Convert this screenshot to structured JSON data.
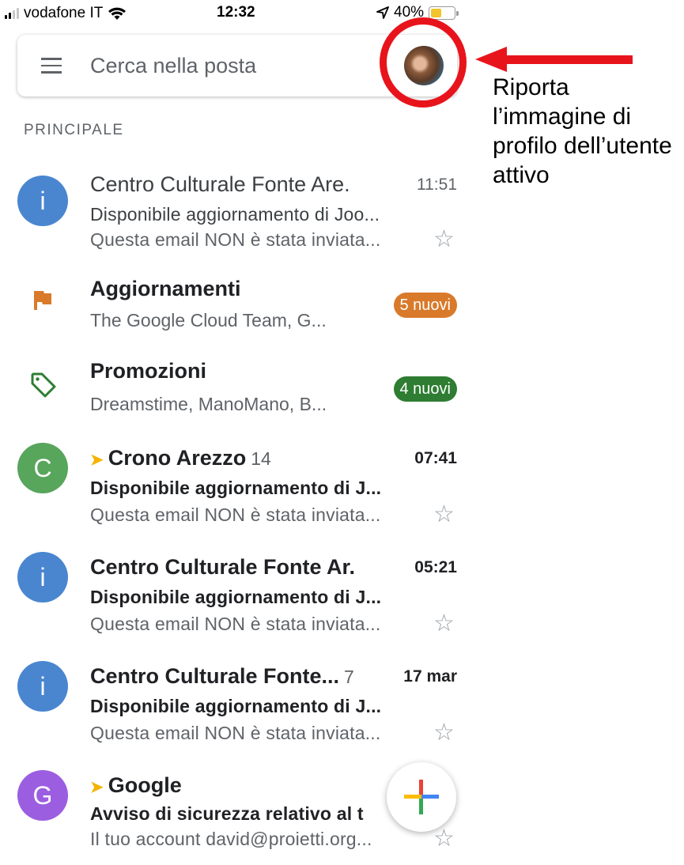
{
  "status_bar": {
    "carrier": "vodafone IT",
    "time": "12:32",
    "battery": "40%",
    "battery_level": 0.4
  },
  "search": {
    "placeholder": "Cerca nella posta"
  },
  "annotation": {
    "text": "Riporta l’immagine di profilo dell’utente attivo"
  },
  "section_label": "PRINCIPALE",
  "categories": [
    {
      "title": "Aggiornamenti",
      "senders": "The Google Cloud Team, G...",
      "badge": "5 nuovi",
      "color": "#d97a2b",
      "icon": "flag-icon"
    },
    {
      "title": "Promozioni",
      "senders": "Dreamstime, ManoMano, B...",
      "badge": "4 nuovi",
      "color": "#2e7d32",
      "icon": "tag-icon"
    }
  ],
  "emails": [
    {
      "avatar": "i",
      "avatar_color": "#4a86d0",
      "sender": "Centro Culturale Fonte Are.",
      "count": "",
      "time": "11:51",
      "subject": "Disponibile aggiornamento di Joo...",
      "snippet": "Questa email NON è stata inviata...",
      "unread": false,
      "important": false
    },
    {
      "avatar": "C",
      "avatar_color": "#58a55c",
      "sender": "Crono Arezzo",
      "count": "14",
      "time": "07:41",
      "subject": "Disponibile aggiornamento di J...",
      "snippet": "Questa email NON è stata inviata...",
      "unread": true,
      "important": true
    },
    {
      "avatar": "i",
      "avatar_color": "#4a86d0",
      "sender": "Centro Culturale Fonte Ar.",
      "count": "",
      "time": "05:21",
      "subject": "Disponibile aggiornamento di J...",
      "snippet": "Questa email NON è stata inviata...",
      "unread": true,
      "important": false
    },
    {
      "avatar": "i",
      "avatar_color": "#4a86d0",
      "sender": "Centro Culturale Fonte...",
      "count": "7",
      "time": "17 mar",
      "subject": "Disponibile aggiornamento di J...",
      "snippet": "Questa email NON è stata inviata...",
      "unread": true,
      "important": false
    },
    {
      "avatar": "G",
      "avatar_color": "#9c5ee0",
      "sender": "Google",
      "count": "",
      "time": "",
      "subject": "Avviso di sicurezza relativo al t",
      "snippet": "Il tuo account david@proietti.org...",
      "unread": true,
      "important": true
    }
  ],
  "colors": {
    "highlight": "#e8141c",
    "important_marker": "#f4b400"
  }
}
